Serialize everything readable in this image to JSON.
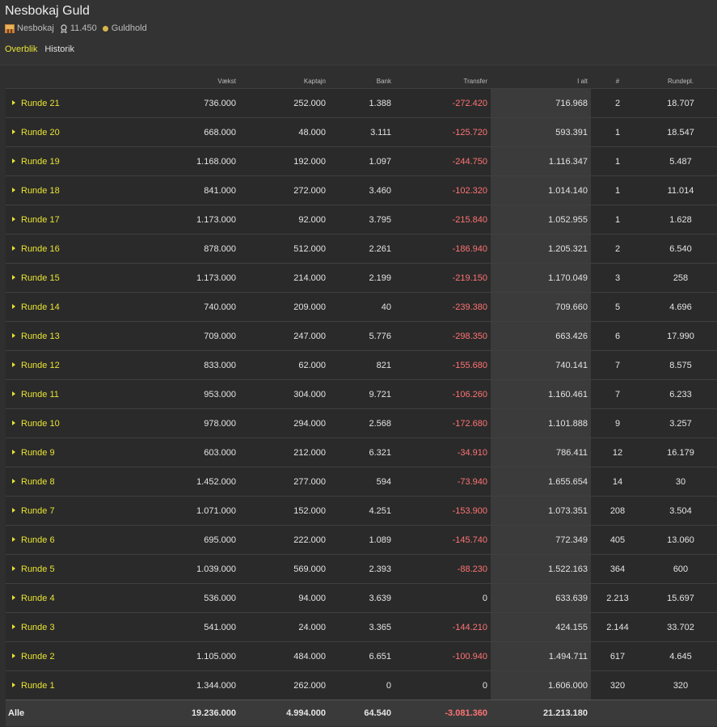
{
  "header": {
    "title": "Nesbokaj Guld",
    "team_name": "Nesbokaj",
    "points": "11.450",
    "league": "Guldhold",
    "tabs": [
      "Overblik",
      "Historik"
    ]
  },
  "columns": [
    "Vækst",
    "Kaptajn",
    "Bank",
    "Transfer",
    "I alt",
    "#",
    "Rundepl."
  ],
  "rows": [
    {
      "name": "Runde 21",
      "vaekst": "736.000",
      "kaptajn": "252.000",
      "bank": "1.388",
      "transfer": "-272.420",
      "ialt": "716.968",
      "rank": "2",
      "rundepl": "18.707"
    },
    {
      "name": "Runde 20",
      "vaekst": "668.000",
      "kaptajn": "48.000",
      "bank": "3.111",
      "transfer": "-125.720",
      "ialt": "593.391",
      "rank": "1",
      "rundepl": "18.547"
    },
    {
      "name": "Runde 19",
      "vaekst": "1.168.000",
      "kaptajn": "192.000",
      "bank": "1.097",
      "transfer": "-244.750",
      "ialt": "1.116.347",
      "rank": "1",
      "rundepl": "5.487"
    },
    {
      "name": "Runde 18",
      "vaekst": "841.000",
      "kaptajn": "272.000",
      "bank": "3.460",
      "transfer": "-102.320",
      "ialt": "1.014.140",
      "rank": "1",
      "rundepl": "11.014"
    },
    {
      "name": "Runde 17",
      "vaekst": "1.173.000",
      "kaptajn": "92.000",
      "bank": "3.795",
      "transfer": "-215.840",
      "ialt": "1.052.955",
      "rank": "1",
      "rundepl": "1.628"
    },
    {
      "name": "Runde 16",
      "vaekst": "878.000",
      "kaptajn": "512.000",
      "bank": "2.261",
      "transfer": "-186.940",
      "ialt": "1.205.321",
      "rank": "2",
      "rundepl": "6.540"
    },
    {
      "name": "Runde 15",
      "vaekst": "1.173.000",
      "kaptajn": "214.000",
      "bank": "2.199",
      "transfer": "-219.150",
      "ialt": "1.170.049",
      "rank": "3",
      "rundepl": "258"
    },
    {
      "name": "Runde 14",
      "vaekst": "740.000",
      "kaptajn": "209.000",
      "bank": "40",
      "transfer": "-239.380",
      "ialt": "709.660",
      "rank": "5",
      "rundepl": "4.696"
    },
    {
      "name": "Runde 13",
      "vaekst": "709.000",
      "kaptajn": "247.000",
      "bank": "5.776",
      "transfer": "-298.350",
      "ialt": "663.426",
      "rank": "6",
      "rundepl": "17.990"
    },
    {
      "name": "Runde 12",
      "vaekst": "833.000",
      "kaptajn": "62.000",
      "bank": "821",
      "transfer": "-155.680",
      "ialt": "740.141",
      "rank": "7",
      "rundepl": "8.575"
    },
    {
      "name": "Runde 11",
      "vaekst": "953.000",
      "kaptajn": "304.000",
      "bank": "9.721",
      "transfer": "-106.260",
      "ialt": "1.160.461",
      "rank": "7",
      "rundepl": "6.233"
    },
    {
      "name": "Runde 10",
      "vaekst": "978.000",
      "kaptajn": "294.000",
      "bank": "2.568",
      "transfer": "-172.680",
      "ialt": "1.101.888",
      "rank": "9",
      "rundepl": "3.257"
    },
    {
      "name": "Runde 9",
      "vaekst": "603.000",
      "kaptajn": "212.000",
      "bank": "6.321",
      "transfer": "-34.910",
      "ialt": "786.411",
      "rank": "12",
      "rundepl": "16.179"
    },
    {
      "name": "Runde 8",
      "vaekst": "1.452.000",
      "kaptajn": "277.000",
      "bank": "594",
      "transfer": "-73.940",
      "ialt": "1.655.654",
      "rank": "14",
      "rundepl": "30"
    },
    {
      "name": "Runde 7",
      "vaekst": "1.071.000",
      "kaptajn": "152.000",
      "bank": "4.251",
      "transfer": "-153.900",
      "ialt": "1.073.351",
      "rank": "208",
      "rundepl": "3.504"
    },
    {
      "name": "Runde 6",
      "vaekst": "695.000",
      "kaptajn": "222.000",
      "bank": "1.089",
      "transfer": "-145.740",
      "ialt": "772.349",
      "rank": "405",
      "rundepl": "13.060"
    },
    {
      "name": "Runde 5",
      "vaekst": "1.039.000",
      "kaptajn": "569.000",
      "bank": "2.393",
      "transfer": "-88.230",
      "ialt": "1.522.163",
      "rank": "364",
      "rundepl": "600"
    },
    {
      "name": "Runde 4",
      "vaekst": "536.000",
      "kaptajn": "94.000",
      "bank": "3.639",
      "transfer": "0",
      "ialt": "633.639",
      "rank": "2.213",
      "rundepl": "15.697"
    },
    {
      "name": "Runde 3",
      "vaekst": "541.000",
      "kaptajn": "24.000",
      "bank": "3.365",
      "transfer": "-144.210",
      "ialt": "424.155",
      "rank": "2.144",
      "rundepl": "33.702"
    },
    {
      "name": "Runde 2",
      "vaekst": "1.105.000",
      "kaptajn": "484.000",
      "bank": "6.651",
      "transfer": "-100.940",
      "ialt": "1.494.711",
      "rank": "617",
      "rundepl": "4.645"
    },
    {
      "name": "Runde 1",
      "vaekst": "1.344.000",
      "kaptajn": "262.000",
      "bank": "0",
      "transfer": "0",
      "ialt": "1.606.000",
      "rank": "320",
      "rundepl": "320"
    }
  ],
  "totals": {
    "label": "Alle",
    "vaekst": "19.236.000",
    "kaptajn": "4.994.000",
    "bank": "64.540",
    "transfer": "-3.081.360",
    "ialt": "21.213.180"
  }
}
